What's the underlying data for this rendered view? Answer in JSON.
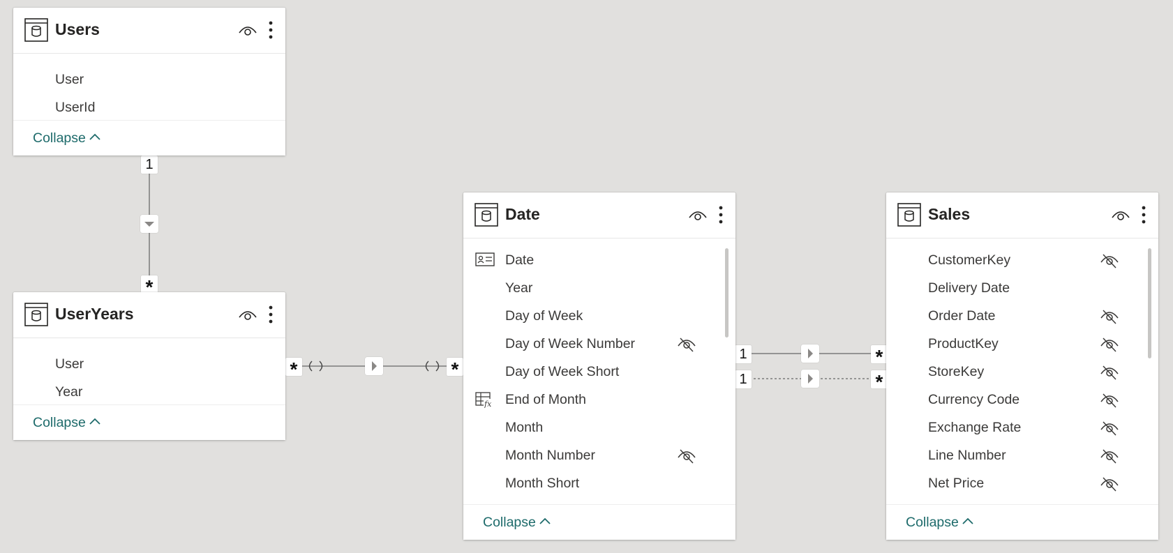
{
  "tables": {
    "users": {
      "title": "Users",
      "fields": [
        "User",
        "UserId"
      ],
      "collapse_label": "Collapse"
    },
    "useryears": {
      "title": "UserYears",
      "fields": [
        "User",
        "Year"
      ],
      "collapse_label": "Collapse"
    },
    "date": {
      "title": "Date",
      "fields": [
        "Date",
        "Year",
        "Day of Week",
        "Day of Week Number",
        "Day of Week Short",
        "End of Month",
        "Month",
        "Month Number",
        "Month Short"
      ],
      "collapse_label": "Collapse"
    },
    "sales": {
      "title": "Sales",
      "fields": [
        "CustomerKey",
        "Delivery Date",
        "Order Date",
        "ProductKey",
        "StoreKey",
        "Currency Code",
        "Exchange Rate",
        "Line Number",
        "Net Price"
      ],
      "collapse_label": "Collapse"
    }
  },
  "relationships": {
    "users_useryears": {
      "from_card": "1",
      "to_card": "*"
    },
    "useryears_date": {
      "from_card": "*",
      "to_card": "*"
    },
    "date_sales_active": {
      "from_card": "1",
      "to_card": "*"
    },
    "date_sales_inactive": {
      "from_card": "1",
      "to_card": "*"
    }
  },
  "icons": {
    "table": "table-icon",
    "visibility": "eye-icon",
    "more": "more-options-icon",
    "hidden": "hidden-eye-icon",
    "date_key": "date-table-icon",
    "measure": "calculated-column-icon",
    "collapse": "chevron-up-icon"
  },
  "colors": {
    "canvas": "#e1e0de",
    "collapse_text": "#1e6b6b",
    "field_text": "#3b3a39",
    "title_text": "#252423"
  }
}
